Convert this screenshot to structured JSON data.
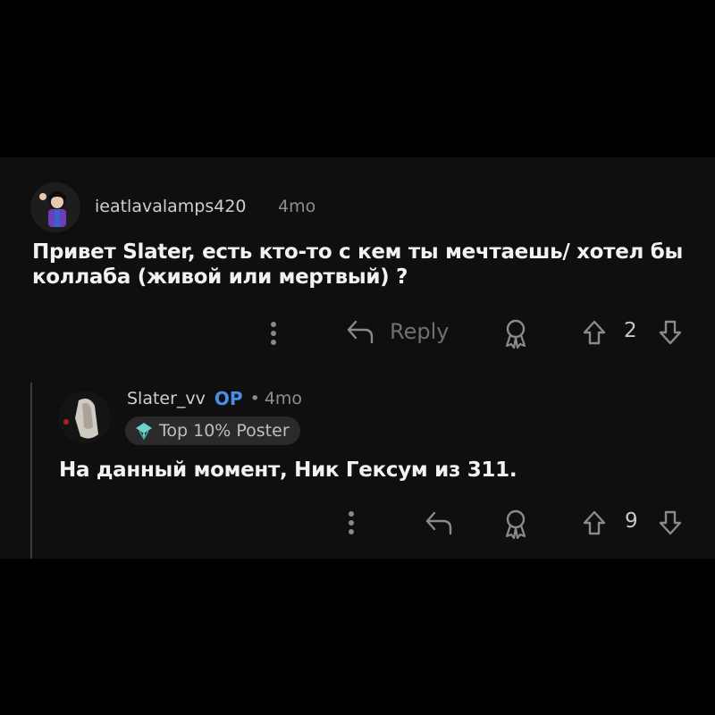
{
  "comment": {
    "author": "ieatlavalamps420",
    "time": "4mo",
    "text_line1": "Привет Slater, есть кто-то с кем ты мечтаешь/ хотел бы",
    "text_line2": "коллаба (живой или мертвый) ?",
    "reply_label": "Reply",
    "score": "2",
    "icons": [
      "more-vertical-icon",
      "reply-arrow-icon",
      "award-icon",
      "upvote-icon",
      "downvote-icon"
    ]
  },
  "reply": {
    "author": "Slater_vv",
    "op_badge": "OP",
    "separator": "•",
    "time": "4mo",
    "flair": "Top 10% Poster",
    "text": "На данный момент, Ник Гексум из 311.",
    "score": "9",
    "icons": [
      "more-vertical-icon",
      "reply-arrow-icon",
      "award-icon",
      "upvote-icon",
      "downvote-icon",
      "flair-badge-icon"
    ]
  },
  "colors": {
    "background": "#000000",
    "panel": "#0f0f0f",
    "op_blue": "#4a8fe7",
    "muted": "#8a8a8a"
  }
}
